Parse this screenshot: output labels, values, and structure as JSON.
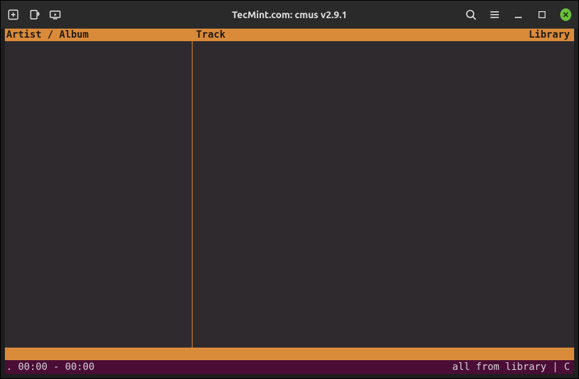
{
  "titlebar": {
    "title": "TecMint.com: cmus v2.9.1"
  },
  "header": {
    "left": "Artist / Album",
    "track": "Track",
    "library": "Library"
  },
  "panes": {
    "left_items": [],
    "right_items": []
  },
  "status": {
    "position": ". 00:00 - 00:00",
    "mode": "all from library | C"
  }
}
